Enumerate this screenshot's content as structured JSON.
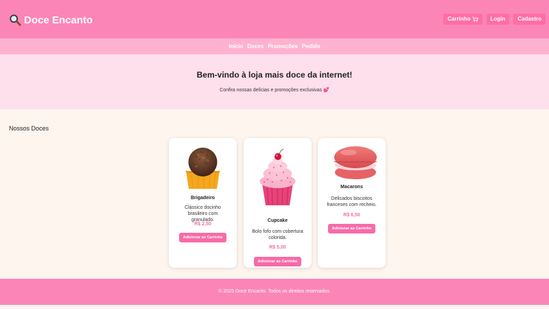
{
  "brand": {
    "name": "Doce Encanto",
    "icon": "magnifier-icon"
  },
  "header": {
    "cart_label": "Carrinho",
    "cart_icon": "cart-icon",
    "login_label": "Login",
    "signup_label": "Cadastro"
  },
  "nav": {
    "items": [
      "Início",
      "Doces",
      "Promoções",
      "Pedido"
    ]
  },
  "hero": {
    "title": "Bem-vindo à loja mais doce da internet!",
    "subtitle": "Confira nossas delícias e promoções exclusivas 💕"
  },
  "products": {
    "section_title": "Nossos Doces",
    "items": [
      {
        "name": "Brigadeiro",
        "description": "Clássico docinho brasileiro com granulado.",
        "price": "R$ 2,50",
        "button": "Adicionar ao Carrinho"
      },
      {
        "name": "Cupcake",
        "description": "Bolo fofo com cobertura colorida.",
        "price": "R$ 5,00",
        "button": "Adicionar ao Carrinho"
      },
      {
        "name": "Macarons",
        "description": "Delicados biscoitos franceses com recheio.",
        "price": "R$ 6,50",
        "button": "Adicionar ao Carrinho"
      }
    ]
  },
  "footer": {
    "text": "© 2025 Doce Encanto. Todos os direitos reservados."
  },
  "colors": {
    "primary": "#fc85b7",
    "nav": "#feb2d0",
    "hero": "#fedfec",
    "page": "#fdf5ee",
    "accent": "#f76ba8"
  }
}
